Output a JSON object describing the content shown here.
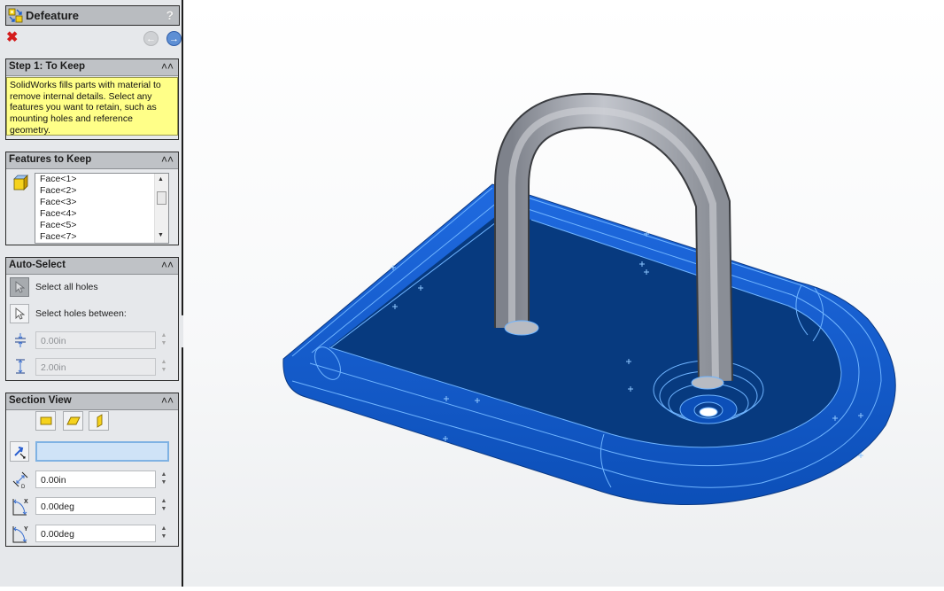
{
  "property_manager": {
    "title": "Defeature",
    "help_glyph": "?",
    "icons": {
      "feature_icon": "defeature-icon",
      "cancel": "close-x-icon",
      "back": "back-arrow-icon",
      "forward": "forward-arrow-icon"
    },
    "cancel_glyph": "✖",
    "back_glyph": "←",
    "forward_glyph": "→"
  },
  "step1": {
    "title": "Step 1: To Keep",
    "collapse_glyph": "«",
    "message": "SolidWorks fills parts with material to remove internal details. Select any features you want to retain, such as mounting holes and reference geometry."
  },
  "features_to_keep": {
    "title": "Features to Keep",
    "collapse_glyph": "«",
    "items": [
      "Face<1>",
      "Face<2>",
      "Face<3>",
      "Face<4>",
      "Face<5>",
      "Face<7>"
    ]
  },
  "auto_select": {
    "title": "Auto-Select",
    "collapse_glyph": "«",
    "select_all_holes": "Select all holes",
    "select_holes_between": "Select holes between:",
    "min_value": "0.00in",
    "max_value": "2.00in"
  },
  "section_view": {
    "title": "Section View",
    "collapse_glyph": "«",
    "plane_buttons": [
      "front-plane",
      "top-plane",
      "right-plane"
    ],
    "selection_value": "",
    "offset_value": "0.00in",
    "x_rotation_value": "0.00deg",
    "y_rotation_value": "0.00deg"
  },
  "spin_up": "▲",
  "spin_down": "▼",
  "flyout_glyph": "◀◀◀",
  "viewport": {
    "model": "defeatured-part-with-u-handle",
    "colors": {
      "selected_face": "#0a3f8f",
      "face_light": "#1a64d6",
      "edge_highlight": "#6fb4ff",
      "handle": "#9ea2ab"
    }
  }
}
